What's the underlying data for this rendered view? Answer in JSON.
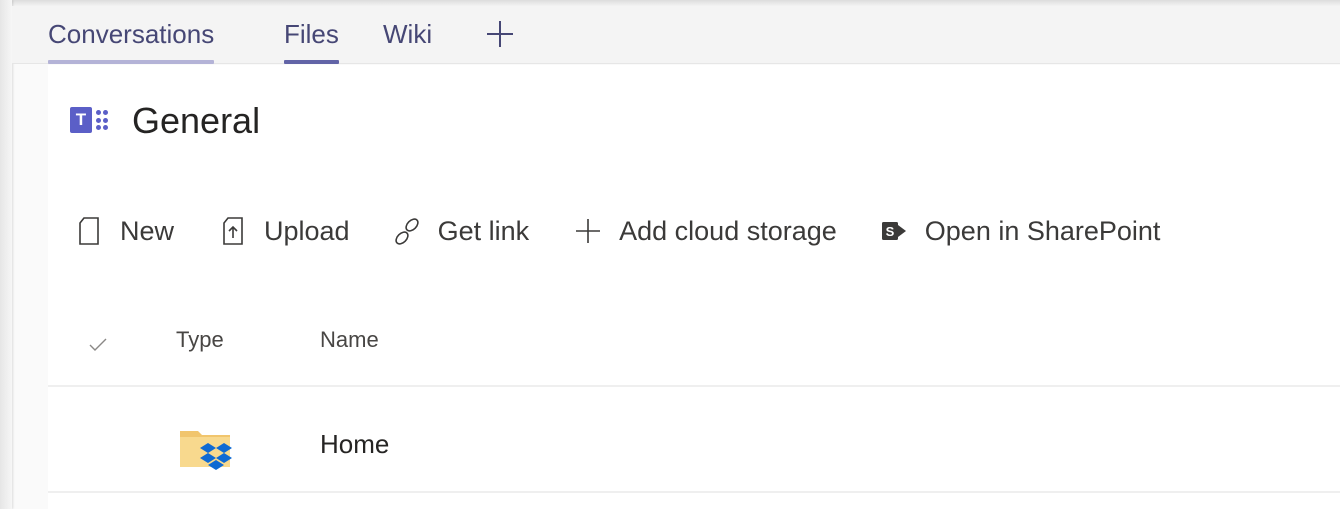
{
  "tabs": [
    {
      "label": "Conversations"
    },
    {
      "label": "Files"
    },
    {
      "label": "Wiki"
    }
  ],
  "channel": {
    "title": "General"
  },
  "toolbar": {
    "new_label": "New",
    "upload_label": "Upload",
    "get_link_label": "Get link",
    "add_cloud_storage_label": "Add cloud storage",
    "open_in_sharepoint_label": "Open in SharePoint"
  },
  "file_list": {
    "columns": {
      "type": "Type",
      "name": "Name"
    },
    "rows": [
      {
        "type_icon": "dropbox-folder-icon",
        "name": "Home"
      }
    ]
  },
  "colors": {
    "accent": "#6264a7",
    "tab_text": "#464775",
    "folder": "#f1c56d",
    "dropbox": "#0f6ad3"
  }
}
